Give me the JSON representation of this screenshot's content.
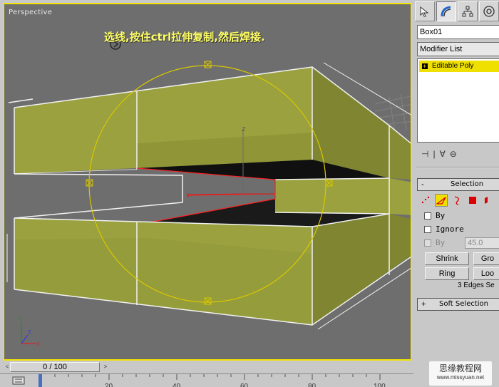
{
  "viewport": {
    "label": "Perspective",
    "caption": "选线,按住ctrl拉伸复制,然后焊接."
  },
  "command_panel": {
    "tab_icons": [
      "create-arrow-icon",
      "modify-icon",
      "hierarchy-icon",
      "motion-icon"
    ],
    "object_name": "Box01",
    "modifier_list_label": "Modifier List",
    "stack": [
      {
        "name": "Editable Poly",
        "highlighted": true
      }
    ],
    "selection_rollout": {
      "collapse_sign": "-",
      "title": "Selection",
      "subobject_icons": [
        "vertex-icon",
        "edge-icon",
        "border-icon",
        "polygon-icon",
        "element-icon"
      ],
      "active_subobject": "edge",
      "by_vertex_label": "By",
      "ignore_backfacing_label": "Ignore",
      "by_angle_label": "By",
      "angle_value": "45.0",
      "shrink_label": "Shrink",
      "grow_label": "Gro",
      "ring_label": "Ring",
      "loop_label": "Loo",
      "status": "3 Edges Se"
    },
    "soft_selection_rollout": {
      "collapse_sign": "+",
      "title": "Soft Selection"
    }
  },
  "timeline": {
    "frame_display": "0 / 100",
    "prev_arrow": "<",
    "next_arrow": ">",
    "ticks": [
      "20",
      "40",
      "60",
      "80",
      "100"
    ]
  },
  "watermark": {
    "line1": "思缘教程网",
    "line2": "www.missyuan.net"
  },
  "colors": {
    "viewport_bg": "#6e6e6e",
    "active_border": "#f2e200",
    "mesh_fill": "#9aa13e",
    "gizmo": "#d9c800",
    "selected_edge": "#ff2020"
  }
}
